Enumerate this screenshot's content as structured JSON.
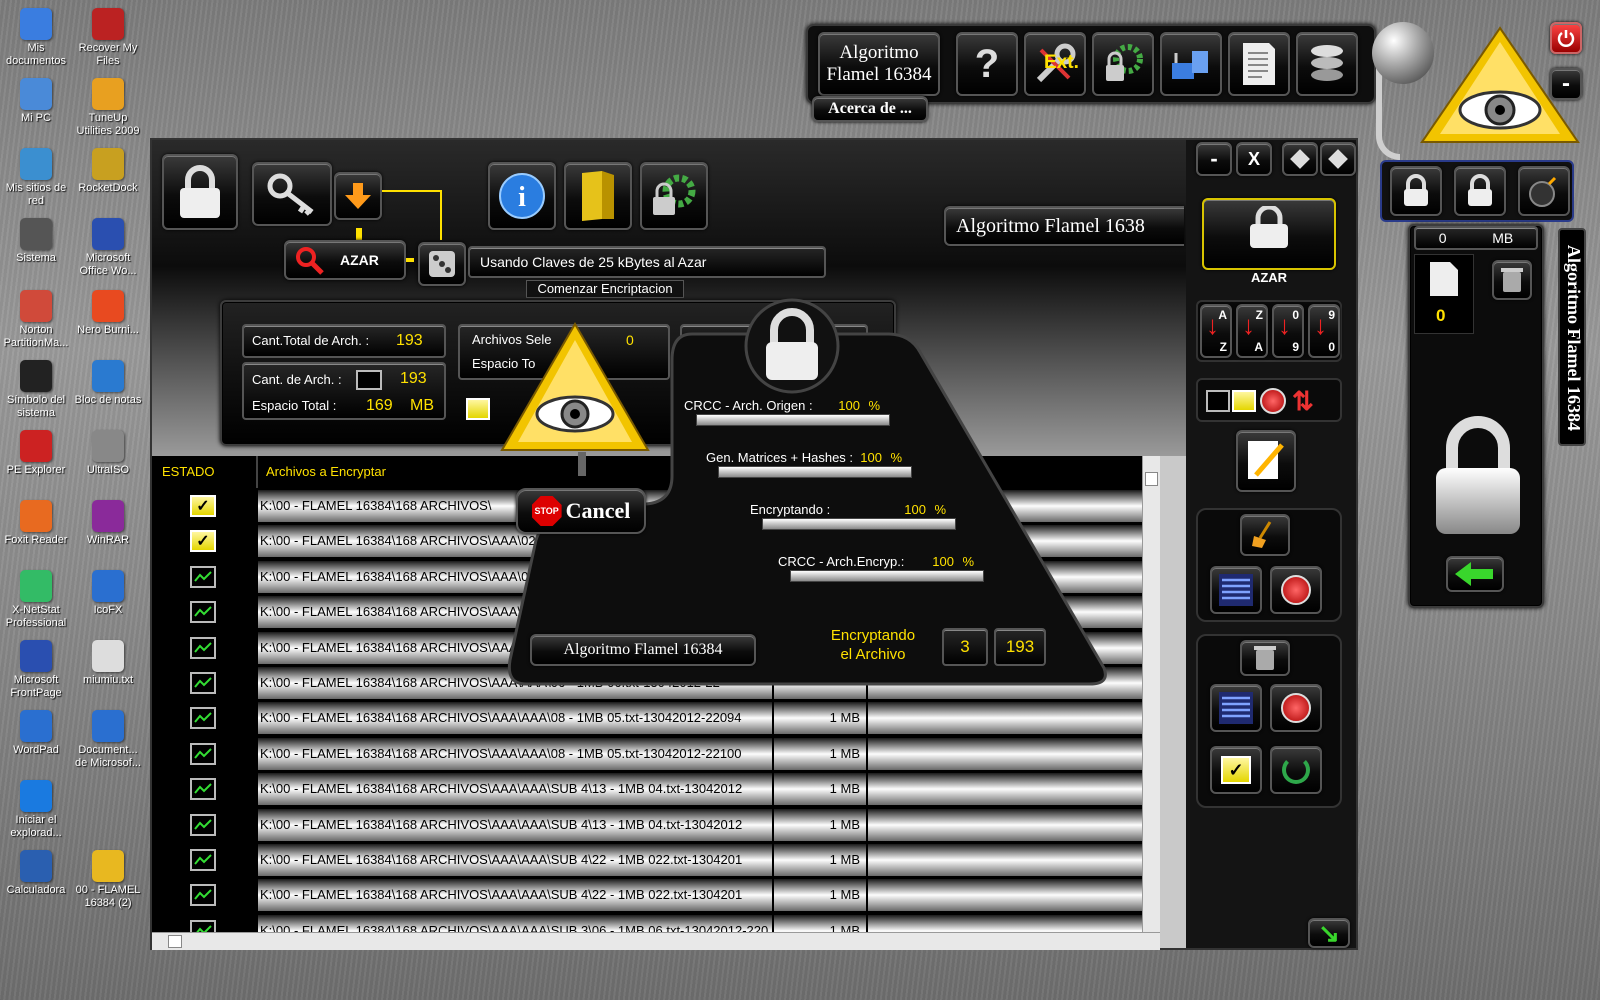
{
  "desktop": {
    "col1": [
      "Mis documentos",
      "Mi PC",
      "Mis sitios de red",
      "Sistema",
      "Norton PartitionMa...",
      "Símbolo del sistema",
      "PE Explorer",
      "Foxit Reader",
      "X-NetStat Professional",
      "Microsoft FrontPage",
      "WordPad",
      "Iniciar el explorad...",
      "Calculadora"
    ],
    "col2": [
      "Recover My Files",
      "TuneUp Utilities 2009",
      "RocketDock",
      "Microsoft Office Wo...",
      "Nero Burni...",
      "Bloc de notas",
      "UltraISO",
      "WinRAR",
      "IcoFX",
      "miumiu.txt",
      "Document... de Microsof...",
      "00 - FLAMEL 16384 (2)"
    ]
  },
  "toolbar": {
    "app_name_line1": "Algoritmo",
    "app_name_line2": "Flamel 16384",
    "help_label": "?",
    "ext_label": "Ext.",
    "about_label": "Acerca de ..."
  },
  "window": {
    "minimize_label": "-",
    "close_label": "X",
    "title": "Algoritmo Flamel 1638",
    "azar_button": "AZAR",
    "keys_text": "Usando Claves de 25 kBytes al Azar",
    "start_label": "Comenzar Encriptacion",
    "total_files_label": "Cant.Total de Arch. :",
    "total_files_value": "193",
    "files_label": "Cant. de Arch. :",
    "files_value": "193",
    "total_space_label": "Espacio Total :",
    "total_space_value": "169",
    "total_space_unit": "MB",
    "selected_label": "Archivos Sele",
    "selected_value": "0",
    "space_label": "Espacio To"
  },
  "table": {
    "col_status": "ESTADO",
    "col_files": "Archivos a Encryptar",
    "rows": [
      {
        "name": "K:\\00 - FLAMEL 16384\\168 ARCHIVOS\\",
        "size": "",
        "checked": true
      },
      {
        "name": "K:\\00 - FLAMEL 16384\\168 ARCHIVOS\\AAA\\02 - 1MB 04.txt-130420",
        "size": "",
        "checked": true
      },
      {
        "name": "K:\\00 - FLAMEL 16384\\168 ARCHIVOS\\AAA\\04 - 1MB 05.txt-13042",
        "size": "",
        "checked": false
      },
      {
        "name": "K:\\00 - FLAMEL 16384\\168 ARCHIVOS\\AAA\\04 - 1MB 05.txt-",
        "size": "",
        "checked": false
      },
      {
        "name": "K:\\00 - FLAMEL 16384\\168 ARCHIVOS\\AAA\\",
        "size": "",
        "checked": false
      },
      {
        "name": "K:\\00 - FLAMEL 16384\\168 ARCHIVOS\\AAA\\AAA\\06 - 1MB 06.txt-13042012-22",
        "size": "",
        "checked": false
      },
      {
        "name": "K:\\00 - FLAMEL 16384\\168 ARCHIVOS\\AAA\\AAA\\08 - 1MB 05.txt-13042012-22094",
        "size": "1 MB",
        "checked": false
      },
      {
        "name": "K:\\00 - FLAMEL 16384\\168 ARCHIVOS\\AAA\\AAA\\08 - 1MB 05.txt-13042012-22100",
        "size": "1 MB",
        "checked": false
      },
      {
        "name": "K:\\00 - FLAMEL 16384\\168 ARCHIVOS\\AAA\\AAA\\SUB 4\\13 - 1MB 04.txt-13042012",
        "size": "1 MB",
        "checked": false
      },
      {
        "name": "K:\\00 - FLAMEL 16384\\168 ARCHIVOS\\AAA\\AAA\\SUB 4\\13 - 1MB 04.txt-13042012",
        "size": "1 MB",
        "checked": false
      },
      {
        "name": "K:\\00 - FLAMEL 16384\\168 ARCHIVOS\\AAA\\AAA\\SUB 4\\22 - 1MB 022.txt-1304201",
        "size": "1 MB",
        "checked": false
      },
      {
        "name": "K:\\00 - FLAMEL 16384\\168 ARCHIVOS\\AAA\\AAA\\SUB 4\\22 - 1MB 022.txt-1304201",
        "size": "1 MB",
        "checked": false
      },
      {
        "name": "K:\\00 - FLAMEL 16384\\168 ARCHIVOS\\AAA\\AAA\\SUB 3\\06 - 1MB 06.txt-13042012-220",
        "size": "1 MB",
        "checked": false
      }
    ]
  },
  "progress": {
    "cancel_label": "Cancel",
    "stop_label": "STOP",
    "crcc_origin_label": "CRCC - Arch. Origen :",
    "crcc_origin_value": "100",
    "gen_matrices_label": "Gen. Matrices + Hashes :",
    "gen_matrices_value": "100",
    "encrypting_label": "Encryptando :",
    "encrypting_value": "100",
    "crcc_encryp_label": "CRCC - Arch.Encryp.:",
    "crcc_encryp_value": "100",
    "percent_sign": "%",
    "status_line1": "Encryptando",
    "status_line2": "el Archivo",
    "current_file": "3",
    "total_file": "193",
    "dialog_title": "Algoritmo Flamel 16384"
  },
  "side": {
    "azar_label": "AZAR",
    "sort_az_top": "A",
    "sort_az_bottom": "Z",
    "sort_za_top": "Z",
    "sort_za_bottom": "A",
    "sort_09_top": "0",
    "sort_09_bottom": "9",
    "sort_90_top": "9",
    "sort_90_bottom": "0"
  },
  "right": {
    "size_value": "0",
    "size_unit": "MB",
    "file_count": "0",
    "vertical_title": "Algoritmo Flamel 16384",
    "min_label": "-"
  }
}
